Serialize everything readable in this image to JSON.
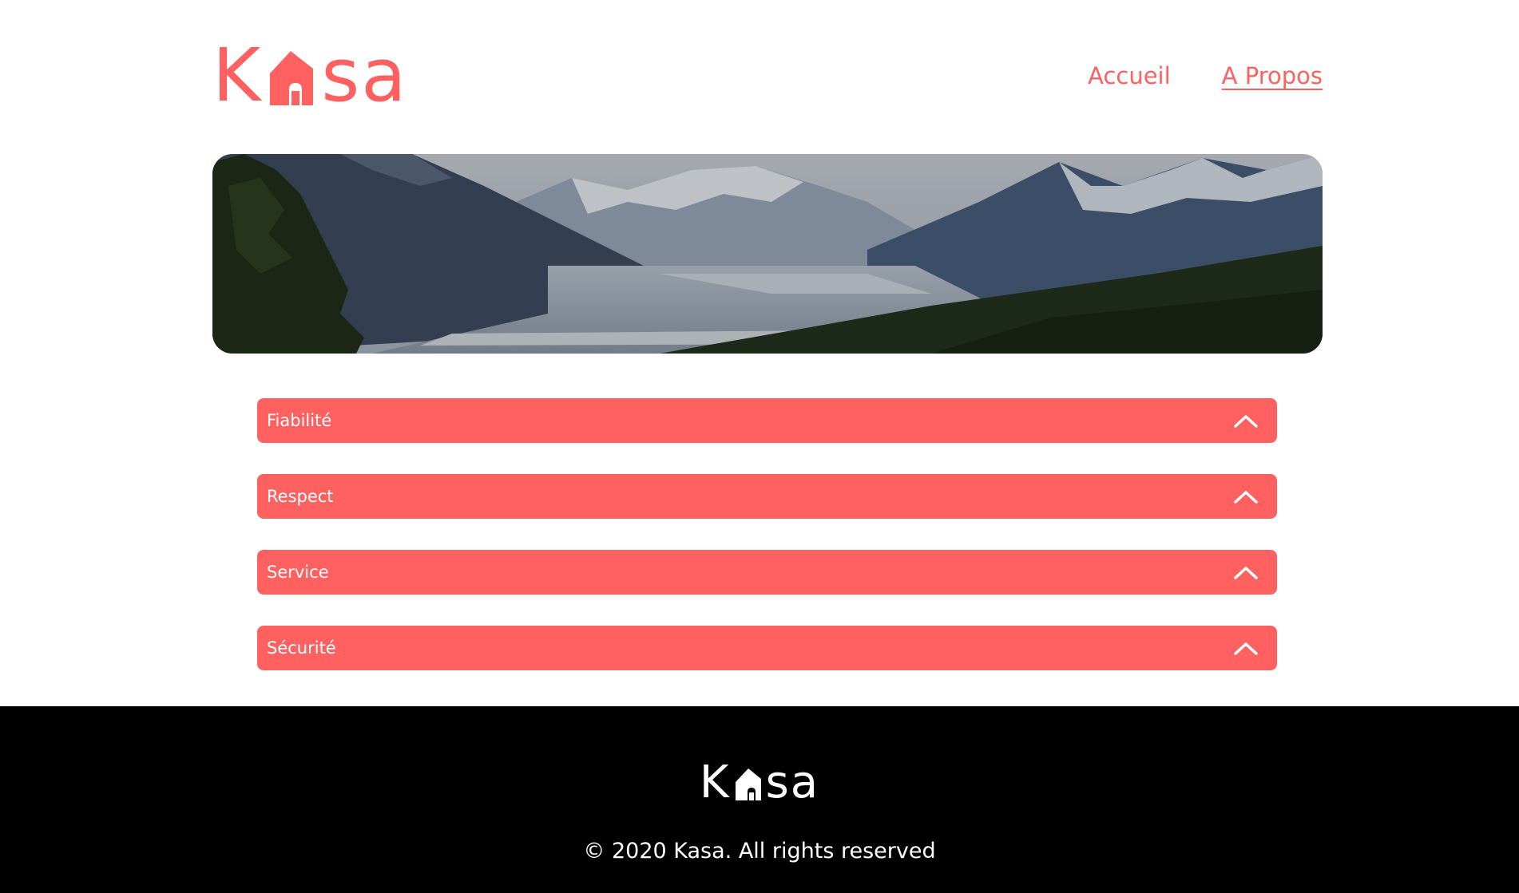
{
  "brand": {
    "logo_parts": [
      "K",
      "sa"
    ],
    "color": "#FF6060"
  },
  "nav": {
    "items": [
      {
        "label": "Accueil",
        "active": false
      },
      {
        "label": "A Propos",
        "active": true
      }
    ]
  },
  "collapses": [
    {
      "title": "Fiabilité",
      "icon": "chevron-up-icon"
    },
    {
      "title": "Respect",
      "icon": "chevron-up-icon"
    },
    {
      "title": "Service",
      "icon": "chevron-up-icon"
    },
    {
      "title": "Sécurité",
      "icon": "chevron-up-icon"
    }
  ],
  "footer": {
    "logo_parts": [
      "K",
      "sa"
    ],
    "copyright": "© 2020 Kasa. All rights reserved"
  },
  "colors": {
    "accent": "#FF6060",
    "footer_bg": "#000000",
    "text_on_accent": "#FFFFFF"
  }
}
